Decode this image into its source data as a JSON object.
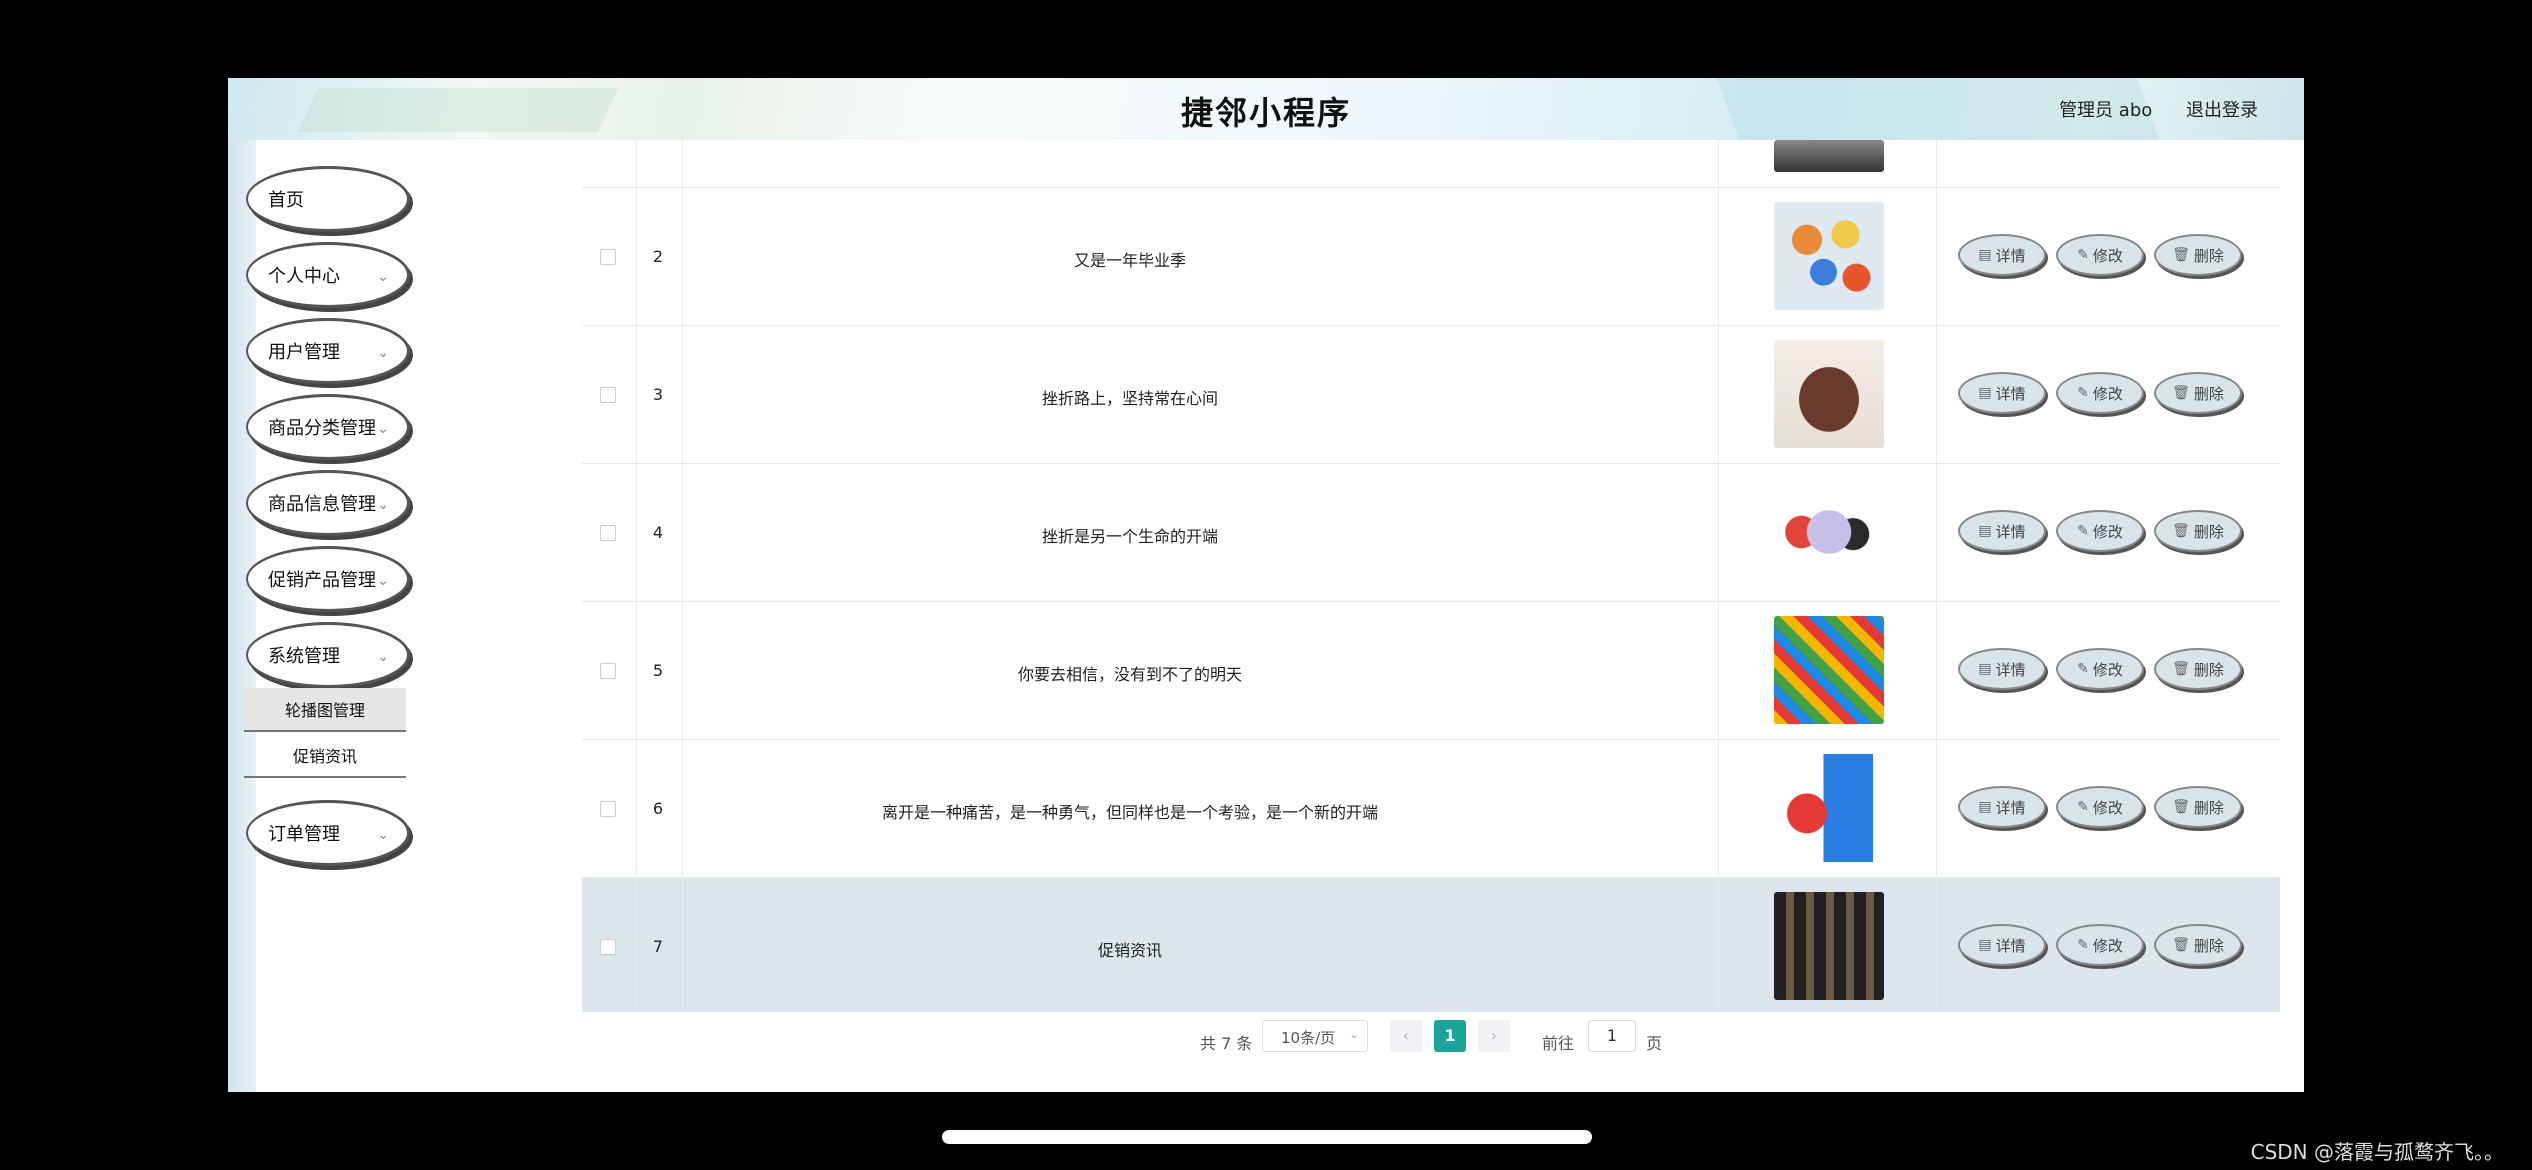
{
  "header": {
    "title": "捷邻小程序",
    "admin": "管理员 abo",
    "logout": "退出登录"
  },
  "sidebar": {
    "items": [
      {
        "label": "首页",
        "chevron": false
      },
      {
        "label": "个人中心",
        "chevron": true
      },
      {
        "label": "用户管理",
        "chevron": true
      },
      {
        "label": "商品分类管理",
        "chevron": true
      },
      {
        "label": "商品信息管理",
        "chevron": true
      },
      {
        "label": "促销产品管理",
        "chevron": true
      },
      {
        "label": "系统管理",
        "chevron": true
      }
    ],
    "sub_items": [
      {
        "label": "轮播图管理",
        "active": true
      },
      {
        "label": "促销资讯",
        "active": false
      }
    ],
    "last_item": {
      "label": "订单管理"
    }
  },
  "table": {
    "rows": [
      {
        "index": "2",
        "title": "又是一年毕业季",
        "image": "food-platter"
      },
      {
        "index": "3",
        "title": "挫折路上，坚持常在心间",
        "image": "brown-handbag"
      },
      {
        "index": "4",
        "title": "挫折是另一个生命的开端",
        "image": "smartphone"
      },
      {
        "index": "5",
        "title": "你要去相信，没有到不了的明天",
        "image": "snack-pile"
      },
      {
        "index": "6",
        "title": "离开是一种痛苦，是一种勇气，但同样也是一个考验，是一个新的开端",
        "image": "shopping-cart-mascot"
      },
      {
        "index": "7",
        "title": "促销资讯",
        "image": "store-shelves",
        "highlighted": true
      }
    ],
    "actions": {
      "detail": "详情",
      "edit": "修改",
      "delete": "删除"
    }
  },
  "pagination": {
    "total": "共 7 条",
    "page_size": "10条/页",
    "current": "1",
    "goto_label": "前往",
    "goto_value": "1",
    "page_suffix": "页"
  },
  "footer": {
    "credit": "CSDN @落霞与孤鹜齐飞。。"
  },
  "colors": {
    "accent": "#1ba59a",
    "highlight_row": "#dbe7ec",
    "action_bg": "#d7e4ea"
  }
}
